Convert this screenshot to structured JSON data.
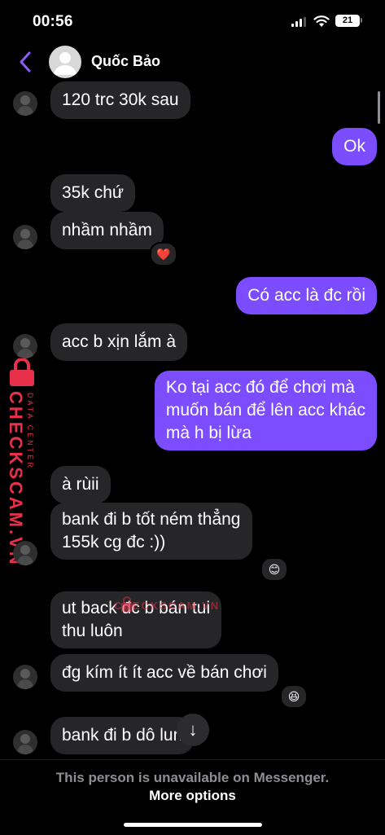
{
  "status_bar": {
    "time": "00:56",
    "battery": "21"
  },
  "header": {
    "contact_name": "Quốc Bảo"
  },
  "messages": [
    {
      "dir": "in",
      "text": "120 trc 30k sau"
    },
    {
      "dir": "out",
      "text": "Ok"
    },
    {
      "dir": "in",
      "text": "35k chứ"
    },
    {
      "dir": "in",
      "text": "nhầm nhầm",
      "reaction": "❤️"
    },
    {
      "dir": "out",
      "text": "Có acc là đc rồi"
    },
    {
      "dir": "in",
      "text": "acc b xịn lắm à"
    },
    {
      "dir": "out",
      "line1": "Ko tại acc đó để chơi mà",
      "line2": "muốn bán để lên acc khác",
      "line3": "mà h bị lừa"
    },
    {
      "dir": "in",
      "text": "à rùii"
    },
    {
      "dir": "in",
      "line1": "bank đi b tốt ném thẳng",
      "line2": "155k cg đc :))",
      "reaction": "😊"
    },
    {
      "dir": "in",
      "line1": "ut back đc b bán tui",
      "line2": "thu luôn"
    },
    {
      "dir": "in",
      "text": "đg kím ít ít acc về bán chơi",
      "reaction": "😆"
    },
    {
      "dir": "in",
      "text": "bank đi b dô  lun"
    }
  ],
  "scroll_down": "↓",
  "footer": {
    "unavailable": "This person is unavailable on Messenger.",
    "more_options": "More options"
  },
  "watermark": {
    "brand": "CHECKSCAM.VN",
    "sub": "DATA CENTER"
  },
  "colors": {
    "outgoing": "#7c4dff",
    "incoming": "#262628",
    "accent": "#8b5cf6",
    "watermark": "#e8304a"
  }
}
